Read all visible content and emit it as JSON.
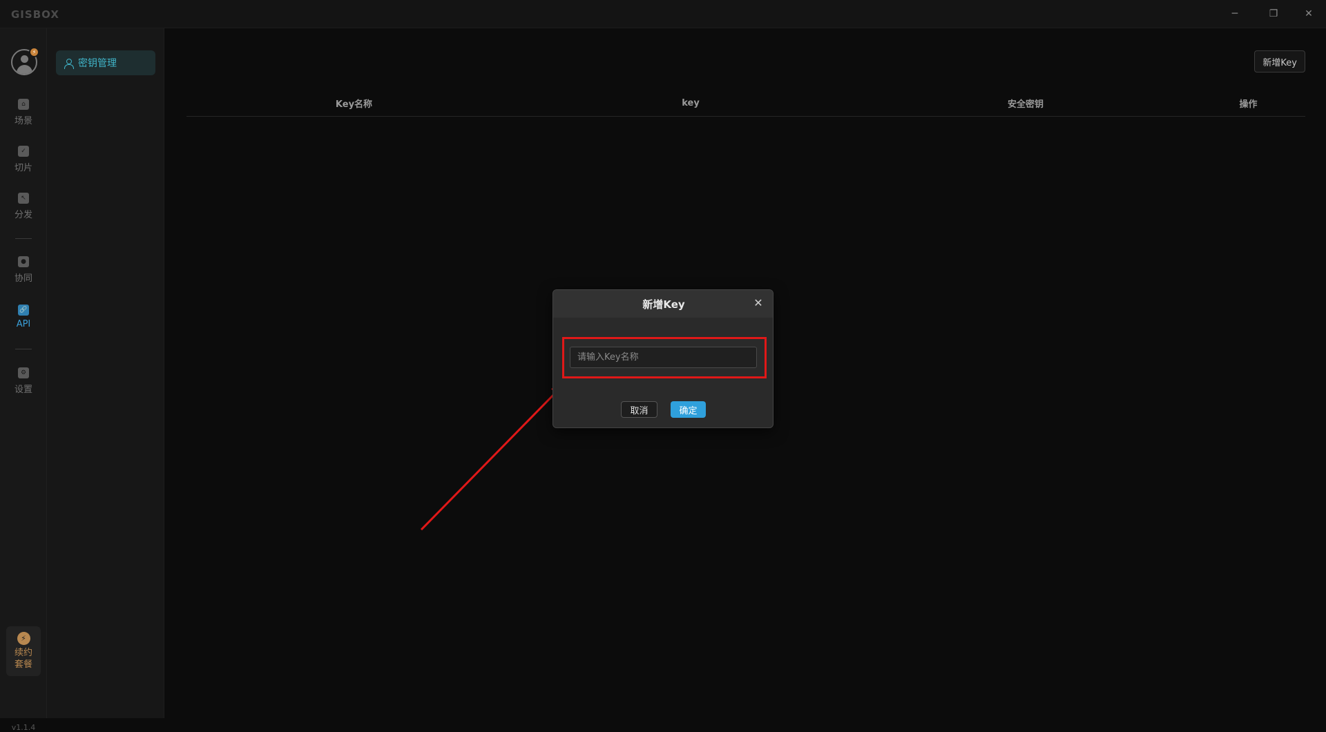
{
  "app": {
    "logo": "GISBOX"
  },
  "window_controls": {
    "minimize": "─",
    "restore": "❐",
    "close": "✕"
  },
  "rail": {
    "avatar_badge": "⚡",
    "items": [
      {
        "label": "场景",
        "icon": "home-icon",
        "glyph": "⌂",
        "active": false
      },
      {
        "label": "切片",
        "icon": "tile-icon",
        "glyph": "✓",
        "active": false
      },
      {
        "label": "分发",
        "icon": "distribute-icon",
        "glyph": "↖",
        "active": false
      },
      {
        "label": "协同",
        "icon": "lock-icon",
        "glyph": "●",
        "active": false
      },
      {
        "label": "API",
        "icon": "link-icon",
        "glyph": "🔗",
        "active": true
      },
      {
        "label": "设置",
        "icon": "gear-icon",
        "glyph": "⚙",
        "active": false
      }
    ],
    "renew": {
      "icon": "bolt-icon",
      "glyph": "⚡",
      "line1": "续约",
      "line2": "套餐"
    },
    "version": "v1.1.4"
  },
  "submenu": {
    "items": [
      {
        "label": "密钥管理",
        "icon": "user-icon"
      }
    ]
  },
  "main": {
    "add_key_button": "新增Key",
    "table": {
      "columns": [
        "Key名称",
        "key",
        "安全密钥",
        "操作"
      ]
    }
  },
  "modal": {
    "title": "新增Key",
    "close": "✕",
    "input_placeholder": "请输入Key名称",
    "input_value": "",
    "cancel": "取消",
    "confirm": "确定"
  },
  "colors": {
    "accent": "#2fa0dc",
    "active_nav": "#3a9fd8",
    "submenu_active": "#40b4c8",
    "annotation_red": "#e01818",
    "renew": "#b88850"
  }
}
